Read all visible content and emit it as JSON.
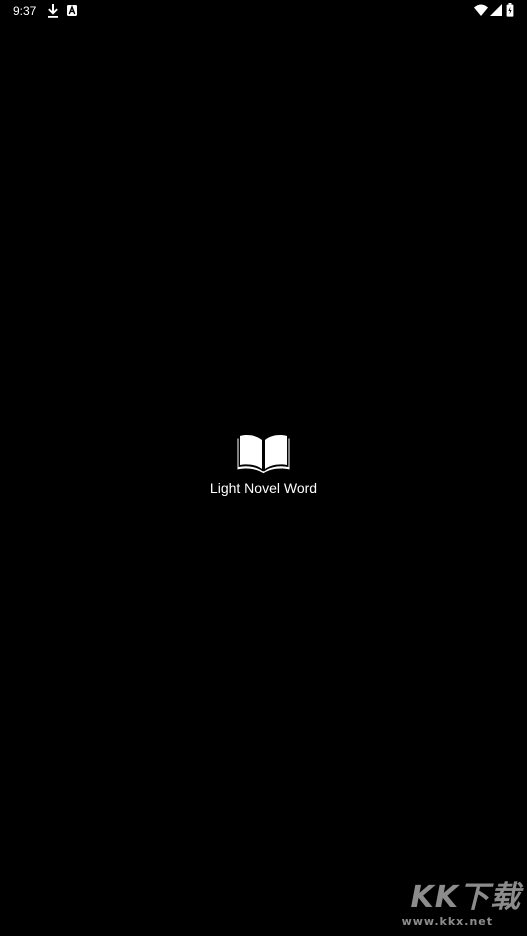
{
  "status_bar": {
    "time": "9:37",
    "left_icons": [
      "download-icon",
      "a-badge-icon"
    ],
    "right_icons": [
      "wifi-icon",
      "signal-icon",
      "battery-icon"
    ]
  },
  "splash": {
    "logo_icon": "open-book-icon",
    "app_name": "Light Novel Word"
  },
  "watermark": {
    "main": "KK下载",
    "sub": "www.kkx.net"
  },
  "colors": {
    "background": "#000000",
    "foreground": "#ffffff"
  }
}
